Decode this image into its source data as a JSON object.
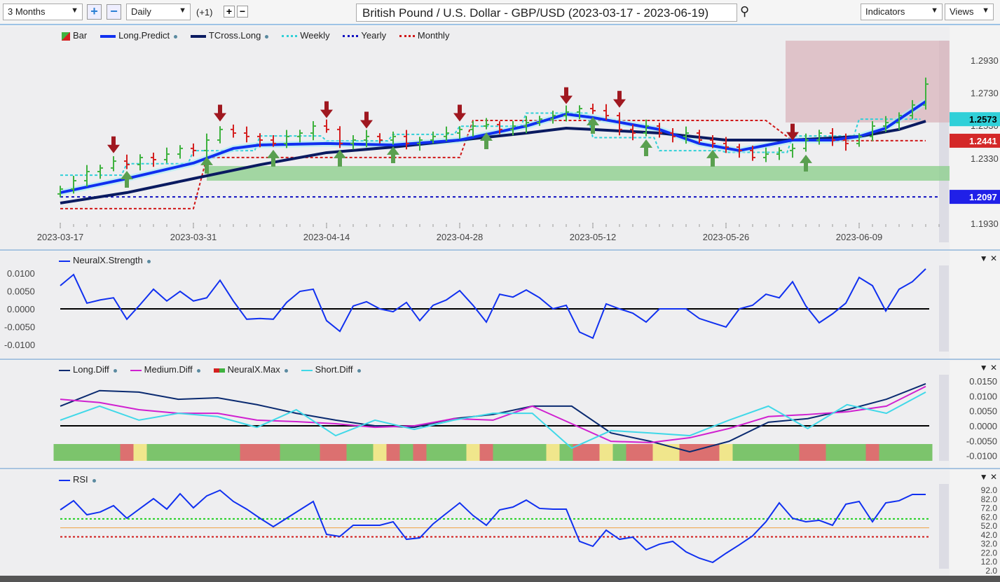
{
  "toolbar": {
    "range": "3 Months",
    "interval": "Daily",
    "offset": "(+1)",
    "title": "British Pound / U.S. Dollar - GBP/USD (2023-03-17 - 2023-06-19)",
    "indicators": "Indicators",
    "views": "Views"
  },
  "colors": {
    "bull": "#3fb23f",
    "bear": "#d42020",
    "long_predict": "#1030f0",
    "tcross": "#0a1a60",
    "weekly": "#30d0d8",
    "yearly": "#1010c0",
    "monthly": "#d01818",
    "band": "#8fcf8f",
    "zone": "#d8b0b8"
  },
  "main": {
    "legend": [
      "Bar",
      "Long.Predict",
      "TCross.Long",
      "Weekly",
      "Yearly",
      "Monthly"
    ],
    "ylabels": [
      "1.2930",
      "1.2730",
      "1.2530",
      "1.2330",
      "1.1930"
    ],
    "yticks": [
      1.293,
      1.273,
      1.253,
      1.233,
      1.193
    ],
    "xlabels": [
      "2023-03-17",
      "2023-03-31",
      "2023-04-14",
      "2023-04-28",
      "2023-05-12",
      "2023-05-26",
      "2023-06-09"
    ],
    "badges": {
      "weekly": "1.2573",
      "monthly": "1.2441",
      "yearly": "1.2097"
    },
    "chart_data": {
      "type": "bar",
      "ylim": [
        1.193,
        1.293
      ],
      "close": [
        1.2145,
        1.2196,
        1.2252,
        1.2274,
        1.2316,
        1.2295,
        1.2338,
        1.2325,
        1.2359,
        1.2394,
        1.2381,
        1.2445,
        1.251,
        1.2488,
        1.2467,
        1.2445,
        1.2424,
        1.2467,
        1.2488,
        1.2531,
        1.251,
        1.2424,
        1.2445,
        1.2467,
        1.2445,
        1.2467,
        1.2424,
        1.2445,
        1.2467,
        1.2488,
        1.251,
        1.2531,
        1.254,
        1.251,
        1.2531,
        1.2552,
        1.2574,
        1.2595,
        1.2617,
        1.2638,
        1.2625,
        1.2595,
        1.251,
        1.2488,
        1.2531,
        1.2488,
        1.2467,
        1.2488,
        1.2445,
        1.2424,
        1.2402,
        1.2381,
        1.2338,
        1.2359,
        1.2381,
        1.2394,
        1.2445,
        1.2488,
        1.2445,
        1.2424,
        1.2467,
        1.2531,
        1.2552,
        1.2595,
        1.266,
        1.2788
      ],
      "long_predict": [
        [
          0,
          1.2123
        ],
        [
          5,
          1.2209
        ],
        [
          10,
          1.2304
        ],
        [
          13,
          1.2394
        ],
        [
          15,
          1.2415
        ],
        [
          20,
          1.2424
        ],
        [
          25,
          1.2415
        ],
        [
          30,
          1.2445
        ],
        [
          35,
          1.2531
        ],
        [
          38,
          1.2604
        ],
        [
          40,
          1.2583
        ],
        [
          45,
          1.251
        ],
        [
          48,
          1.2424
        ],
        [
          51,
          1.2381
        ],
        [
          55,
          1.2445
        ],
        [
          58,
          1.2445
        ],
        [
          60,
          1.2467
        ],
        [
          62,
          1.2518
        ],
        [
          65,
          1.2681
        ]
      ],
      "tcross_long": [
        [
          0,
          1.2059
        ],
        [
          5,
          1.2123
        ],
        [
          10,
          1.2209
        ],
        [
          15,
          1.2294
        ],
        [
          20,
          1.2368
        ],
        [
          25,
          1.2402
        ],
        [
          30,
          1.2445
        ],
        [
          35,
          1.2488
        ],
        [
          38,
          1.2518
        ],
        [
          40,
          1.251
        ],
        [
          45,
          1.2488
        ],
        [
          50,
          1.2445
        ],
        [
          55,
          1.2445
        ],
        [
          60,
          1.2467
        ],
        [
          63,
          1.251
        ],
        [
          65,
          1.2561
        ]
      ],
      "weekly": [
        1.223,
        1.23,
        1.238,
        1.247,
        1.244,
        1.248,
        1.253,
        1.261,
        1.246,
        1.238,
        1.237,
        1.247,
        1.2573
      ],
      "monthly": [
        [
          0,
          1.2025
        ],
        [
          10,
          1.2025
        ],
        [
          11,
          1.2338
        ],
        [
          30,
          1.2338
        ],
        [
          31,
          1.2565
        ],
        [
          53,
          1.2565
        ],
        [
          55,
          1.2441
        ],
        [
          65,
          1.2441
        ]
      ],
      "yearly": 1.2097,
      "support_band": [
        1.2196,
        1.2286
      ],
      "zone": {
        "from_bar": 55,
        "top": 1.3054,
        "bottom": 1.2553
      },
      "down_arrows": [
        4,
        12,
        20,
        23,
        30,
        38,
        42,
        55
      ],
      "up_arrows": [
        5,
        11,
        16,
        21,
        25,
        32,
        40,
        44,
        49,
        56
      ]
    }
  },
  "strength": {
    "legend": "NeuralX.Strength",
    "ylabels": [
      "0.0100",
      "0.0050",
      "0.0000",
      "-0.0050",
      "-0.0100"
    ],
    "chart_data": {
      "type": "line",
      "ylim": [
        -0.0125,
        0.0125
      ],
      "values": [
        0.0065,
        0.0096,
        0.0016,
        0.0025,
        0.0031,
        -0.0029,
        0.0012,
        0.0055,
        0.0022,
        0.0049,
        0.0022,
        0.0031,
        0.008,
        0.0022,
        -0.0029,
        -0.0027,
        -0.0029,
        0.0018,
        0.0049,
        0.0055,
        -0.0033,
        -0.0063,
        0.0008,
        0.002,
        0.0,
        -0.0008,
        0.0018,
        -0.0033,
        0.001,
        0.0025,
        0.0051,
        0.001,
        -0.0037,
        0.0041,
        0.0033,
        0.0053,
        0.0031,
        0.0,
        0.001,
        -0.0065,
        -0.0082,
        0.0014,
        0.0,
        -0.0012,
        -0.0037,
        0,
        0,
        0,
        -0.0027,
        -0.0039,
        -0.0051,
        0,
        0.001,
        0.0041,
        0.0031,
        0.0076,
        0.0008,
        -0.0039,
        -0.0014,
        0.0016,
        0.0088,
        0.0065,
        -0.0006,
        0.0055,
        0.0076,
        0.0112
      ]
    }
  },
  "diff": {
    "legend": [
      "Long.Diff",
      "Medium.Diff",
      "NeuralX.Max",
      "Short.Diff"
    ],
    "ylabels": [
      "0.0150",
      "0.0100",
      "0.0050",
      "0.0000",
      "-0.0050",
      "-0.0100"
    ],
    "chart_data": {
      "type": "line",
      "ylim": [
        -0.0138,
        0.0175
      ],
      "series": [
        {
          "name": "Long.Diff",
          "color": "#0a2a70",
          "values": [
            0.0066,
            0.0118,
            0.0113,
            0.0089,
            0.0094,
            0.0071,
            0.0042,
            0.0019,
            0,
            -0.0005,
            0.0024,
            0.0038,
            0.0066,
            0.0066,
            -0.0024,
            -0.0052,
            -0.0087,
            -0.0052,
            0.0012,
            0.0024,
            0.0054,
            0.0089,
            0.0141
          ]
        },
        {
          "name": "Medium.Diff",
          "color": "#d020d0",
          "values": [
            0.0089,
            0.0078,
            0.0054,
            0.0042,
            0.0042,
            0.0019,
            0.0014,
            0.0007,
            -0.0005,
            0,
            0.0024,
            0.0019,
            0.0066,
            0.0007,
            -0.0052,
            -0.0056,
            -0.004,
            -0.0009,
            0.0031,
            0.0038,
            0.0047,
            0.0066,
            0.0132
          ]
        },
        {
          "name": "Short.Diff",
          "color": "#40d8e8",
          "values": [
            0.0019,
            0.0066,
            0.0019,
            0.0042,
            0.0031,
            -0.0005,
            0.0054,
            -0.0033,
            0.0019,
            -0.0012,
            0.0019,
            0.0042,
            0.0042,
            -0.0075,
            -0.0016,
            -0.0024,
            -0.0033,
            0.0019,
            0.0066,
            -0.0009,
            0.0071,
            0.0042,
            0.0113
          ]
        }
      ],
      "neuralx_max": "GGGGGRYGGGGGGGRRRGGGRRGGYRGRGGGYRGGGGYGRRYGRRYYRRRYGGGGGRRGGGRGGGG",
      "state_colors": {
        "G": "#7cc46c",
        "R": "#dc7070",
        "Y": "#f0e68c"
      }
    }
  },
  "rsi": {
    "legend": "RSI",
    "ylabels": [
      "92.0",
      "82.0",
      "72.0",
      "62.0",
      "52.0",
      "42.0",
      "32.0",
      "22.0",
      "12.0",
      "2.0"
    ],
    "chart_data": {
      "type": "line",
      "ylim": [
        2,
        92
      ],
      "levels": [
        60,
        50,
        40
      ],
      "values": [
        70.1,
        80.3,
        64.6,
        67.7,
        74.8,
        60.7,
        71.7,
        82.6,
        70.9,
        88.1,
        72.4,
        85.7,
        92,
        79.5,
        70.9,
        60.7,
        51.3,
        60.7,
        70.1,
        79.5,
        42.7,
        40.4,
        52.9,
        52.9,
        52.9,
        56.8,
        37.2,
        38.8,
        54.4,
        66.2,
        77.9,
        63.8,
        52.9,
        70.1,
        73.2,
        81.0,
        71.7,
        70.9,
        70.9,
        34.9,
        29.4,
        47.4,
        37.2,
        39.6,
        25.5,
        31.7,
        34.9,
        23.1,
        16.1,
        11.4,
        21.6,
        31.0,
        41.1,
        56.8,
        77.9,
        60.7,
        56.8,
        58.4,
        52.9,
        76.4,
        79.5,
        56.8,
        77.9,
        80.3,
        87.3,
        87.3
      ]
    }
  }
}
